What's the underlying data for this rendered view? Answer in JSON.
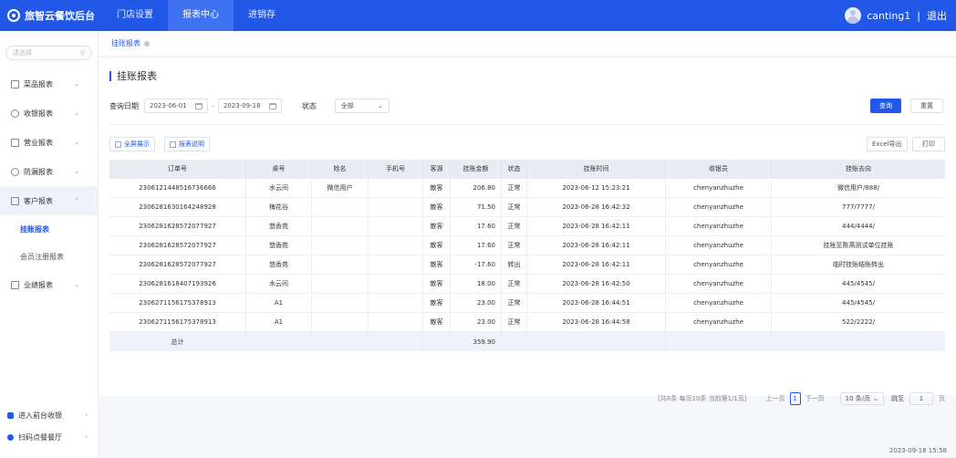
{
  "app": {
    "logo_text": "旅智云餐饮后台"
  },
  "nav": [
    {
      "label": "门店设置",
      "active": false
    },
    {
      "label": "报表中心",
      "active": true
    },
    {
      "label": "进销存",
      "active": false
    }
  ],
  "user": {
    "name": "canting1",
    "separator": "|",
    "logout": "退出"
  },
  "sidebar": {
    "search_placeholder": "请选择",
    "items": [
      {
        "label": "菜品报表"
      },
      {
        "label": "收银报表"
      },
      {
        "label": "营业报表"
      },
      {
        "label": "防漏报表"
      },
      {
        "label": "客户报表"
      },
      {
        "label": "业绩报表"
      }
    ],
    "sub_items": [
      {
        "label": "挂账报表",
        "active": true
      },
      {
        "label": "会员注册报表",
        "active": false
      }
    ],
    "bottom": [
      {
        "label": "进入前台收银"
      },
      {
        "label": "扫码点餐餐厅"
      }
    ]
  },
  "tab": {
    "label": "挂账报表"
  },
  "page": {
    "title": "挂账报表"
  },
  "filters": {
    "date_label": "查询日期",
    "date_start": "2023-06-01",
    "date_separator": "-",
    "date_end": "2023-09-18",
    "status_label": "状态",
    "status_value": "全部",
    "query_button": "查询",
    "reset_button": "重置"
  },
  "toolbar": {
    "fullscreen": "全屏展示",
    "report_desc": "报表说明",
    "excel_export": "Excel导出",
    "print": "打印"
  },
  "table": {
    "headers": [
      "订单号",
      "桌号",
      "姓名",
      "手机号",
      "客源",
      "挂账金额",
      "状态",
      "挂账时间",
      "收银员",
      "挂账去向"
    ],
    "rows": [
      [
        "23061214485167366​66",
        "水云间",
        "微信用户",
        "",
        "散客",
        "206.80",
        "正常",
        "2023-06-12 15:23:21",
        "chenyanzhuzhe",
        "微信用户/888/"
      ],
      [
        "2306281630164248928",
        "梅花谷",
        "",
        "",
        "散客",
        "71.50",
        "正常",
        "2023-06-28 16:42:32",
        "chenyanzhuzhe",
        "777/7777/"
      ],
      [
        "2306281628572077927",
        "悠香苑",
        "",
        "",
        "散客",
        "17.60",
        "正常",
        "2023-06-28 16:42:11",
        "chenyanzhuzhe",
        "444/4444/"
      ],
      [
        "2306281628572077927",
        "悠香苑",
        "",
        "",
        "散客",
        "17.60",
        "正常",
        "2023-06-28 16:42:11",
        "chenyanzhuzhe",
        "挂账至陈燕测试单位挂账"
      ],
      [
        "2306281628572077927",
        "悠香苑",
        "",
        "",
        "散客",
        "-17.60",
        "转出",
        "2023-06-28 16:42:11",
        "chenyanzhuzhe",
        "临时挂账结账转出"
      ],
      [
        "2306281618407193926",
        "水云间",
        "",
        "",
        "散客",
        "18.00",
        "正常",
        "2023-06-28 16:42:50",
        "chenyanzhuzhe",
        "445/4545/"
      ],
      [
        "2306271156175378913",
        "A1",
        "",
        "",
        "散客",
        "23.00",
        "正常",
        "2023-06-28 16:44:51",
        "chenyanzhuzhe",
        "445/4545/"
      ],
      [
        "2306271156175378913",
        "A1",
        "",
        "",
        "散客",
        "23.00",
        "正常",
        "2023-06-28 16:44:58",
        "chenyanzhuzhe",
        "522/2222/"
      ]
    ],
    "total_label": "总计",
    "total_amount": "359.90"
  },
  "pager": {
    "info": "[共8条 每页10条 当前第1/1页]",
    "prev": "上一页",
    "current": "1",
    "next": "下一页",
    "page_size": "10 条/页",
    "goto_label": "跳至",
    "goto_value": "1",
    "page_unit": "页"
  },
  "footer": {
    "timestamp": "2023-09-18 15:58"
  }
}
